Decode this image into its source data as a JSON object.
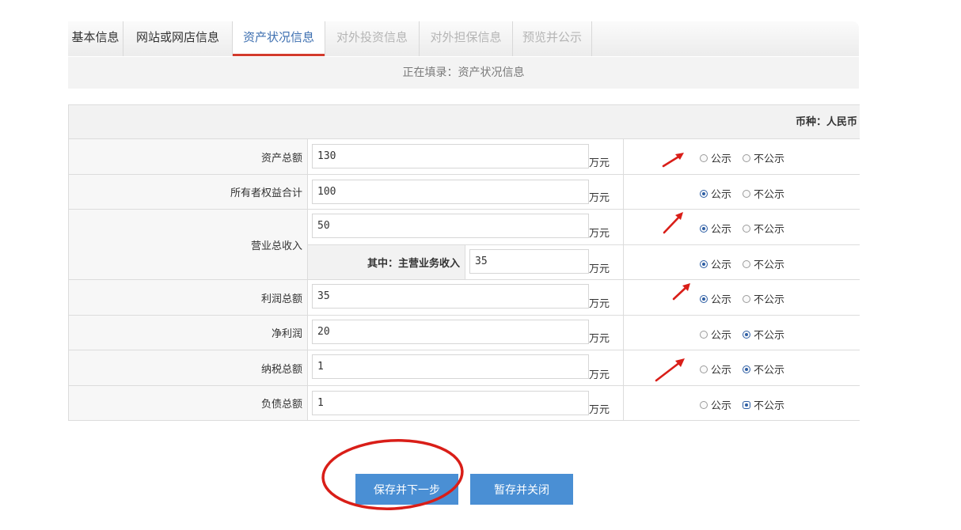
{
  "tabs": [
    {
      "label": "基本信息",
      "state": "done"
    },
    {
      "label": "网站或网店信息",
      "state": "done"
    },
    {
      "label": "资产状况信息",
      "state": "active"
    },
    {
      "label": "对外投资信息",
      "state": "todo"
    },
    {
      "label": "对外担保信息",
      "state": "todo"
    },
    {
      "label": "预览并公示",
      "state": "todo"
    }
  ],
  "status_text": "正在填录：资产状况信息",
  "currency_text": "币种：人民币",
  "unit": "万元",
  "radio_labels": {
    "public": "公示",
    "private": "不公示"
  },
  "rows": [
    {
      "label": "资产总额",
      "value": "130",
      "publicity": "none"
    },
    {
      "label": "所有者权益合计",
      "value": "100",
      "publicity": "public"
    },
    {
      "label": "营业总收入",
      "value": "50",
      "publicity": "public"
    },
    {
      "label": "其中：主营业务收入",
      "value": "35",
      "publicity": "public"
    },
    {
      "label": "利润总额",
      "value": "35",
      "publicity": "public"
    },
    {
      "label": "净利润",
      "value": "20",
      "publicity": "private"
    },
    {
      "label": "纳税总额",
      "value": "1",
      "publicity": "private"
    },
    {
      "label": "负债总额",
      "value": "1",
      "publicity": "private"
    }
  ],
  "buttons": {
    "save_next": "保存并下一步",
    "save_close": "暂存并关闭"
  },
  "colors": {
    "active_tab_text": "#3d6fb0",
    "active_tab_underline": "#d33a2c",
    "button_bg": "#4a8fd4",
    "annotation_red": "#d91e18"
  }
}
